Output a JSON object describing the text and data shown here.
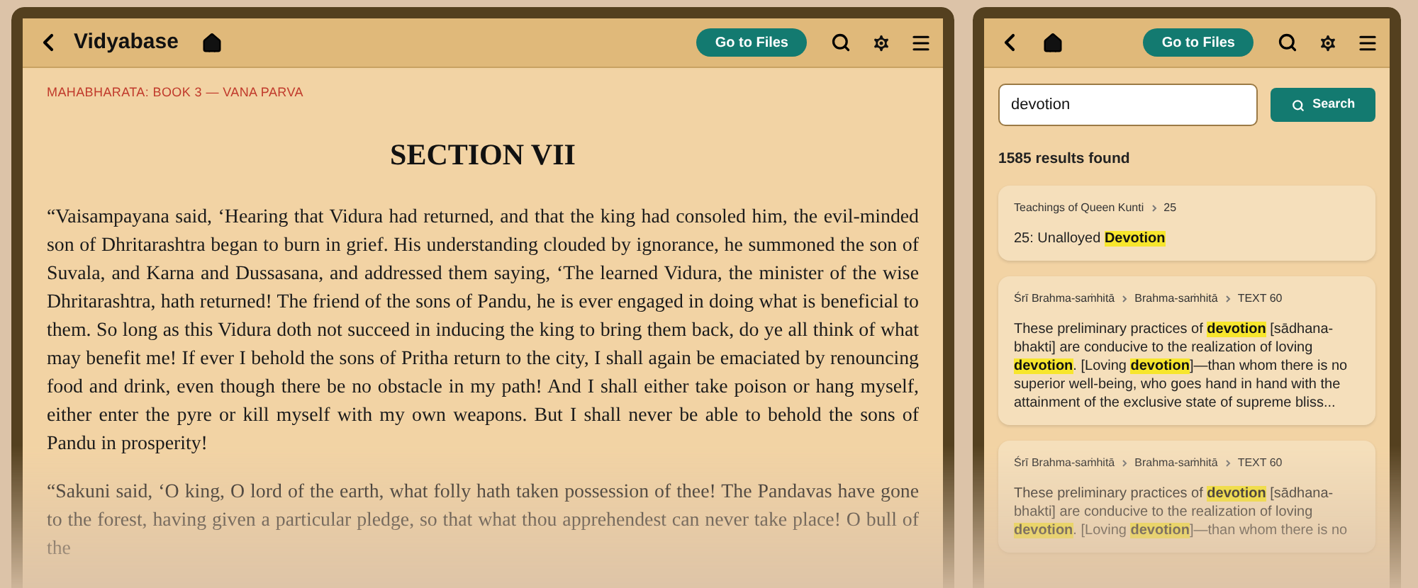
{
  "reader": {
    "header": {
      "title": "Vidyabase",
      "files_button": "Go to Files"
    },
    "breadcrumb": "MAHABHARATA: BOOK 3 — VANA PARVA",
    "heading": "SECTION VII",
    "paragraphs": [
      "“Vaisampayana said, ‘Hearing that Vidura had returned, and that the king had consoled him, the evil-minded son of Dhritarashtra began to burn in grief. His understanding clouded by ignorance, he summoned the son of Suvala, and Karna and Dussasana, and addressed them saying, ‘The learned Vidura, the minister of the wise Dhritarashtra, hath returned! The friend of the sons of Pandu, he is ever engaged in doing what is beneficial to them. So long as this Vidura doth not succeed in inducing the king to bring them back, do ye all think of what may benefit me! If ever I behold the sons of Pritha return to the city, I shall again be emaciated by renouncing food and drink, even though there be no obstacle in my path! And I shall either take poison or hang myself, either enter the pyre or kill myself with my own weapons. But I shall never be able to behold the sons of Pandu in prosperity!",
      "“Sakuni said, ‘O king, O lord of the earth, what folly hath taken possession of thee! The Pandavas have gone to the forest, having given a particular pledge, so that what thou apprehendest can never take place! O bull of the"
    ]
  },
  "search": {
    "header": {
      "files_button": "Go to Files"
    },
    "query": "devotion",
    "search_button": "Search",
    "count": "1585 results found",
    "results": [
      {
        "path": [
          "Teachings of Queen Kunti",
          "25"
        ],
        "segments": [
          {
            "text": "25: Unalloyed ",
            "highlight": false
          },
          {
            "text": "Devotion",
            "highlight": true
          }
        ]
      },
      {
        "path": [
          "Śrī Brahma-saṁhitā",
          "Brahma-saṁhitā",
          "TEXT 60"
        ],
        "segments": [
          {
            "text": "These preliminary practices of ",
            "highlight": false
          },
          {
            "text": "devotion",
            "highlight": true
          },
          {
            "text": " [sādhana-bhakti] are conducive to the realization of loving ",
            "highlight": false
          },
          {
            "text": "devotion",
            "highlight": true
          },
          {
            "text": ". [Loving ",
            "highlight": false
          },
          {
            "text": "devotion",
            "highlight": true
          },
          {
            "text": "]—than whom there is no superior well-being, who goes hand in hand with the attainment of the exclusive state of supreme bliss...",
            "highlight": false
          }
        ]
      },
      {
        "path": [
          "Śrī Brahma-saṁhitā",
          "Brahma-saṁhitā",
          "TEXT 60"
        ],
        "segments": [
          {
            "text": "These preliminary practices of ",
            "highlight": false
          },
          {
            "text": "devotion",
            "highlight": true
          },
          {
            "text": " [sādhana-bhakti] are conducive to the realization of loving ",
            "highlight": false
          },
          {
            "text": "devotion",
            "highlight": true
          },
          {
            "text": ". [Loving ",
            "highlight": false
          },
          {
            "text": "devotion",
            "highlight": true
          },
          {
            "text": "]—than whom there is no",
            "highlight": false
          }
        ]
      }
    ]
  }
}
